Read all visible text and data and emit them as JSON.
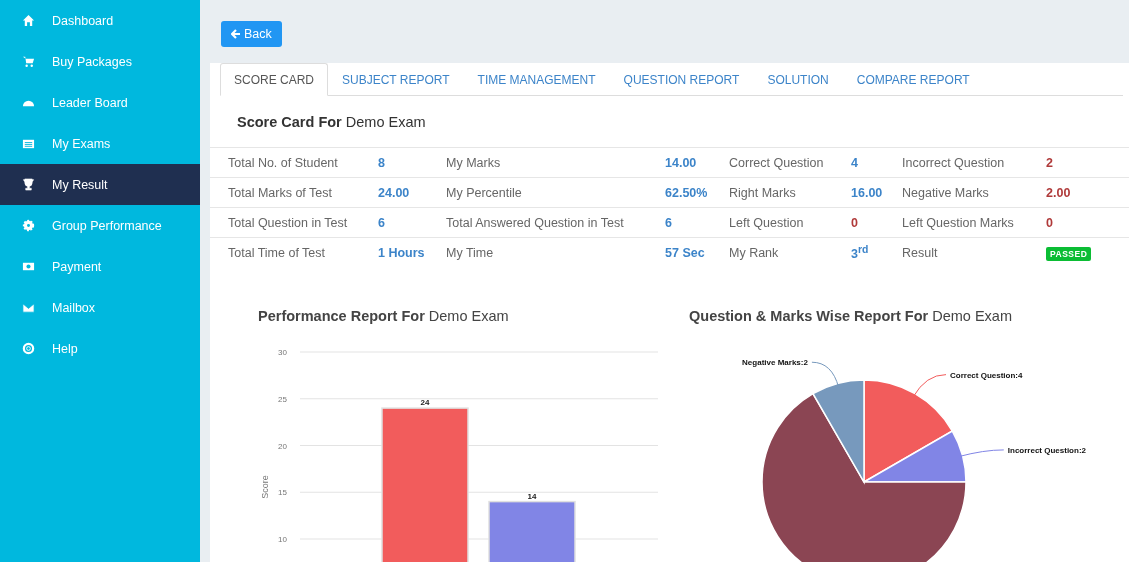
{
  "sidebar": {
    "items": [
      {
        "label": "Dashboard",
        "selected": false
      },
      {
        "label": "Buy Packages",
        "selected": false
      },
      {
        "label": "Leader Board",
        "selected": false
      },
      {
        "label": "My Exams",
        "selected": false
      },
      {
        "label": "My Result",
        "selected": true
      },
      {
        "label": "Group Performance",
        "selected": false
      },
      {
        "label": "Payment",
        "selected": false
      },
      {
        "label": "Mailbox",
        "selected": false
      },
      {
        "label": "Help",
        "selected": false
      }
    ]
  },
  "back_button": "Back",
  "tabs": [
    {
      "label": "SCORE CARD",
      "selected": true
    },
    {
      "label": "SUBJECT REPORT",
      "selected": false
    },
    {
      "label": "TIME MANAGEMENT",
      "selected": false
    },
    {
      "label": "QUESTION REPORT",
      "selected": false
    },
    {
      "label": "SOLUTION",
      "selected": false
    },
    {
      "label": "COMPARE REPORT",
      "selected": false
    }
  ],
  "score_card": {
    "title": "**Score Card For** Demo Exam",
    "rows": [
      [
        {
          "label": "Total No. of Student",
          "value": "8",
          "kind": "value"
        },
        {
          "label": "My Marks",
          "value": "14.00",
          "kind": "value"
        },
        {
          "label": "Correct Question",
          "value": "4",
          "kind": "value"
        },
        {
          "label": "Incorrect Question",
          "value": "2",
          "kind": "negative"
        }
      ],
      [
        {
          "label": "Total Marks of Test",
          "value": "24.00",
          "kind": "value"
        },
        {
          "label": "My Percentile",
          "value": "62.50%",
          "kind": "value"
        },
        {
          "label": "Right Marks",
          "value": "16.00",
          "kind": "value"
        },
        {
          "label": "Negative Marks",
          "value": "2.00",
          "kind": "negative"
        }
      ],
      [
        {
          "label": "Total Question in Test",
          "value": "6",
          "kind": "value"
        },
        {
          "label": "Total Answered Question in Test",
          "value": "6",
          "kind": "value"
        },
        {
          "label": "Left Question",
          "value": "0",
          "kind": "negative"
        },
        {
          "label": "Left Question Marks",
          "value": "0",
          "kind": "negative"
        }
      ],
      [
        {
          "label": "Total Time of Test",
          "value": "1 Hours",
          "kind": "value"
        },
        {
          "label": "My Time",
          "value": "57 Sec",
          "kind": "value"
        },
        {
          "label": "My Rank",
          "value": "3$^{rd}$",
          "kind": "value"
        },
        {
          "label": "Result",
          "value": "PASSED",
          "kind": "badge"
        }
      ]
    ]
  },
  "performance_report": {
    "title": "**Performance Report For** Demo Exam",
    "chart_data": {
      "type": "bar",
      "ylabel": "Score",
      "values": [
        24,
        14
      ],
      "colors": [
        "#f25c5c",
        "#8185e6"
      ],
      "ylim": [
        0,
        30
      ],
      "yticks": [
        10,
        15,
        20,
        25,
        30
      ],
      "grid": true,
      "value_labels": [
        "24",
        "14"
      ]
    }
  },
  "marks_report": {
    "title": "**Question & Marks Wise Report For** Demo Exam",
    "chart_data": {
      "type": "pie",
      "values": [
        4,
        2,
        16,
        2
      ],
      "colors": [
        "#f25c5c",
        "#8185e6",
        "#8b4553",
        "#7799bd"
      ],
      "value_labels": [
        "Correct Question:4",
        "Incorrect Question:2",
        null,
        "Negative Marks:2"
      ]
    }
  }
}
